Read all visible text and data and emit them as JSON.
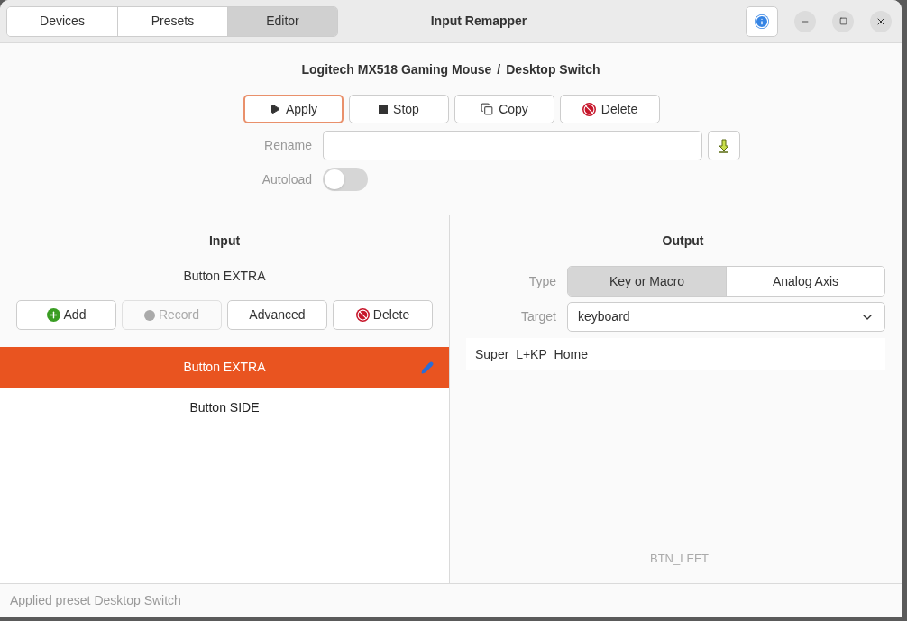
{
  "window": {
    "title": "Input Remapper"
  },
  "tabs": [
    {
      "label": "Devices",
      "selected": false
    },
    {
      "label": "Presets",
      "selected": false
    },
    {
      "label": "Editor",
      "selected": true
    }
  ],
  "heading": {
    "device": "Logitech MX518 Gaming Mouse",
    "separator": "/",
    "preset": "Desktop Switch"
  },
  "preset_buttons": [
    {
      "kind": "apply",
      "label": "Apply",
      "focused": true
    },
    {
      "kind": "stop",
      "label": "Stop",
      "focused": false
    },
    {
      "kind": "copy",
      "label": "Copy",
      "focused": false
    },
    {
      "kind": "delete",
      "label": "Delete",
      "focused": false
    }
  ],
  "rename": {
    "label": "Rename"
  },
  "autoload": {
    "label": "Autoload",
    "on": false
  },
  "input": {
    "title": "Input",
    "current": "Button EXTRA",
    "buttons": [
      {
        "kind": "add",
        "label": "Add",
        "disabled": false
      },
      {
        "kind": "record",
        "label": "Record",
        "disabled": true
      },
      {
        "kind": "advanced",
        "label": "Advanced",
        "disabled": false
      },
      {
        "kind": "delete",
        "label": "Delete",
        "disabled": false
      }
    ],
    "items": [
      {
        "label": "Button EXTRA",
        "selected": true
      },
      {
        "label": "Button SIDE",
        "selected": false
      }
    ]
  },
  "output": {
    "title": "Output",
    "type_label": "Type",
    "types": [
      {
        "label": "Key or Macro",
        "selected": true
      },
      {
        "label": "Analog Axis",
        "selected": false
      }
    ],
    "target_label": "Target",
    "target": "keyboard",
    "mapping": "Super_L+KP_Home",
    "hint": "BTN_LEFT"
  },
  "status_bar": "Applied preset Desktop Switch"
}
